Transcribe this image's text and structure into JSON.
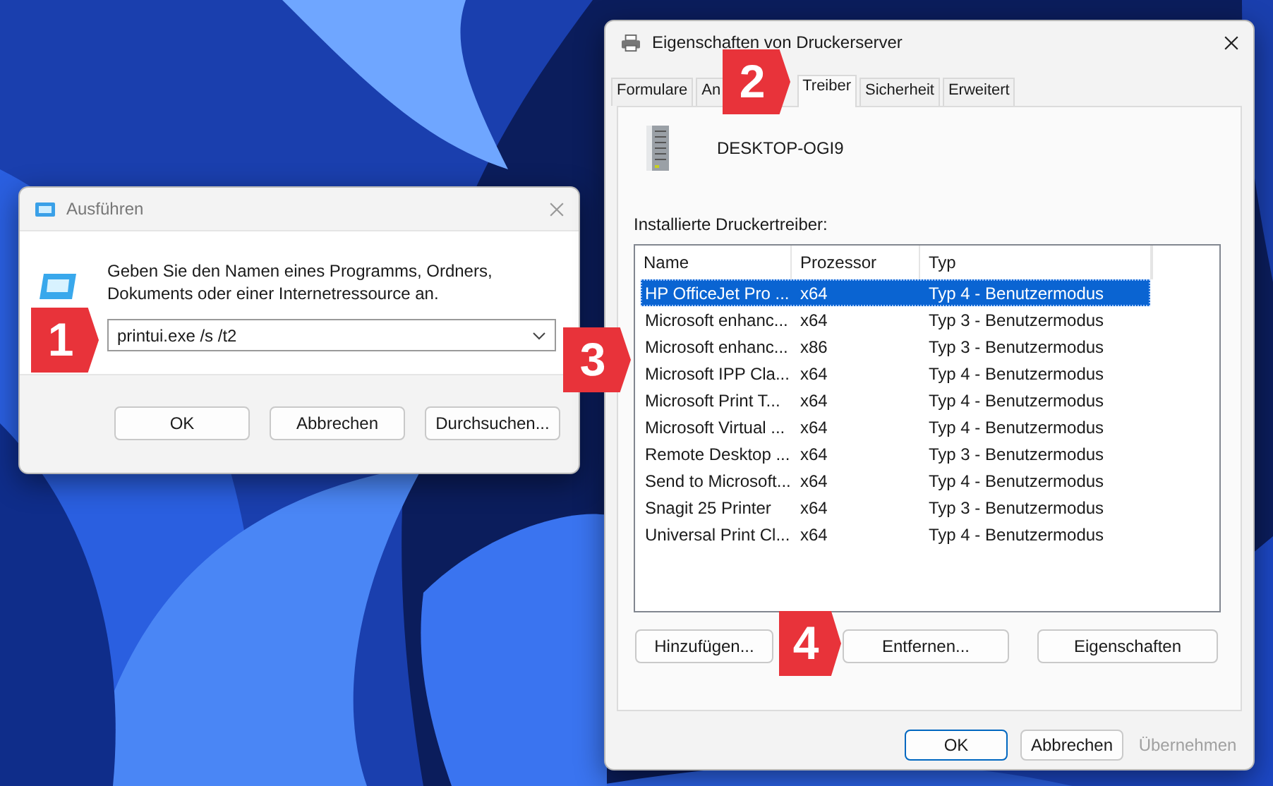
{
  "run_dialog": {
    "title": "Ausführen",
    "prompt": "Geben Sie den Namen eines Programms, Ordners, Dokuments oder einer Internetressource an.",
    "input_value": "printui.exe /s /t2",
    "buttons": [
      {
        "label": "OK",
        "default": false,
        "disabled": false
      },
      {
        "label": "Abbrechen",
        "default": false,
        "disabled": false
      },
      {
        "label": "Durchsuchen...",
        "default": false,
        "disabled": false
      }
    ]
  },
  "properties_dialog": {
    "title": "Eigenschaften von Druckerserver",
    "tabs": [
      {
        "label": "Formulare",
        "selected": false
      },
      {
        "label": "An",
        "selected": false
      },
      {
        "label": "Treiber",
        "selected": true
      },
      {
        "label": "Sicherheit",
        "selected": false
      },
      {
        "label": "Erweitert",
        "selected": false
      }
    ],
    "server_name": "DESKTOP-OGI9",
    "list_label": "Installierte Druckertreiber:",
    "table": {
      "columns": [
        "Name",
        "Prozessor",
        "Typ"
      ],
      "rows": [
        {
          "cells": [
            "HP OfficeJet Pro ...",
            "x64",
            "Typ 4 - Benutzermodus"
          ],
          "selected": true
        },
        {
          "cells": [
            "Microsoft enhanc...",
            "x64",
            "Typ 3 - Benutzermodus"
          ],
          "selected": false
        },
        {
          "cells": [
            "Microsoft enhanc...",
            "x86",
            "Typ 3 - Benutzermodus"
          ],
          "selected": false
        },
        {
          "cells": [
            "Microsoft IPP Cla...",
            "x64",
            "Typ 4 - Benutzermodus"
          ],
          "selected": false
        },
        {
          "cells": [
            "Microsoft Print T...",
            "x64",
            "Typ 4 - Benutzermodus"
          ],
          "selected": false
        },
        {
          "cells": [
            "Microsoft Virtual ...",
            "x64",
            "Typ 4 - Benutzermodus"
          ],
          "selected": false
        },
        {
          "cells": [
            "Remote Desktop ...",
            "x64",
            "Typ 3 - Benutzermodus"
          ],
          "selected": false
        },
        {
          "cells": [
            "Send to Microsoft...",
            "x64",
            "Typ 4 - Benutzermodus"
          ],
          "selected": false
        },
        {
          "cells": [
            "Snagit 25 Printer",
            "x64",
            "Typ 3 - Benutzermodus"
          ],
          "selected": false
        },
        {
          "cells": [
            "Universal Print Cl...",
            "x64",
            "Typ 4 - Benutzermodus"
          ],
          "selected": false
        }
      ]
    },
    "list_buttons": [
      {
        "label": "Hinzufügen...",
        "default": false,
        "disabled": false
      },
      {
        "label": "Entfernen...",
        "default": false,
        "disabled": false
      },
      {
        "label": "Eigenschaften",
        "default": false,
        "disabled": false
      }
    ],
    "buttons": [
      {
        "label": "OK",
        "default": true,
        "disabled": false
      },
      {
        "label": "Abbrechen",
        "default": false,
        "disabled": false
      },
      {
        "label": "Übernehmen",
        "default": false,
        "disabled": true
      }
    ]
  },
  "step_markers": [
    {
      "number": "1"
    },
    {
      "number": "2"
    },
    {
      "number": "3"
    },
    {
      "number": "4"
    }
  ]
}
